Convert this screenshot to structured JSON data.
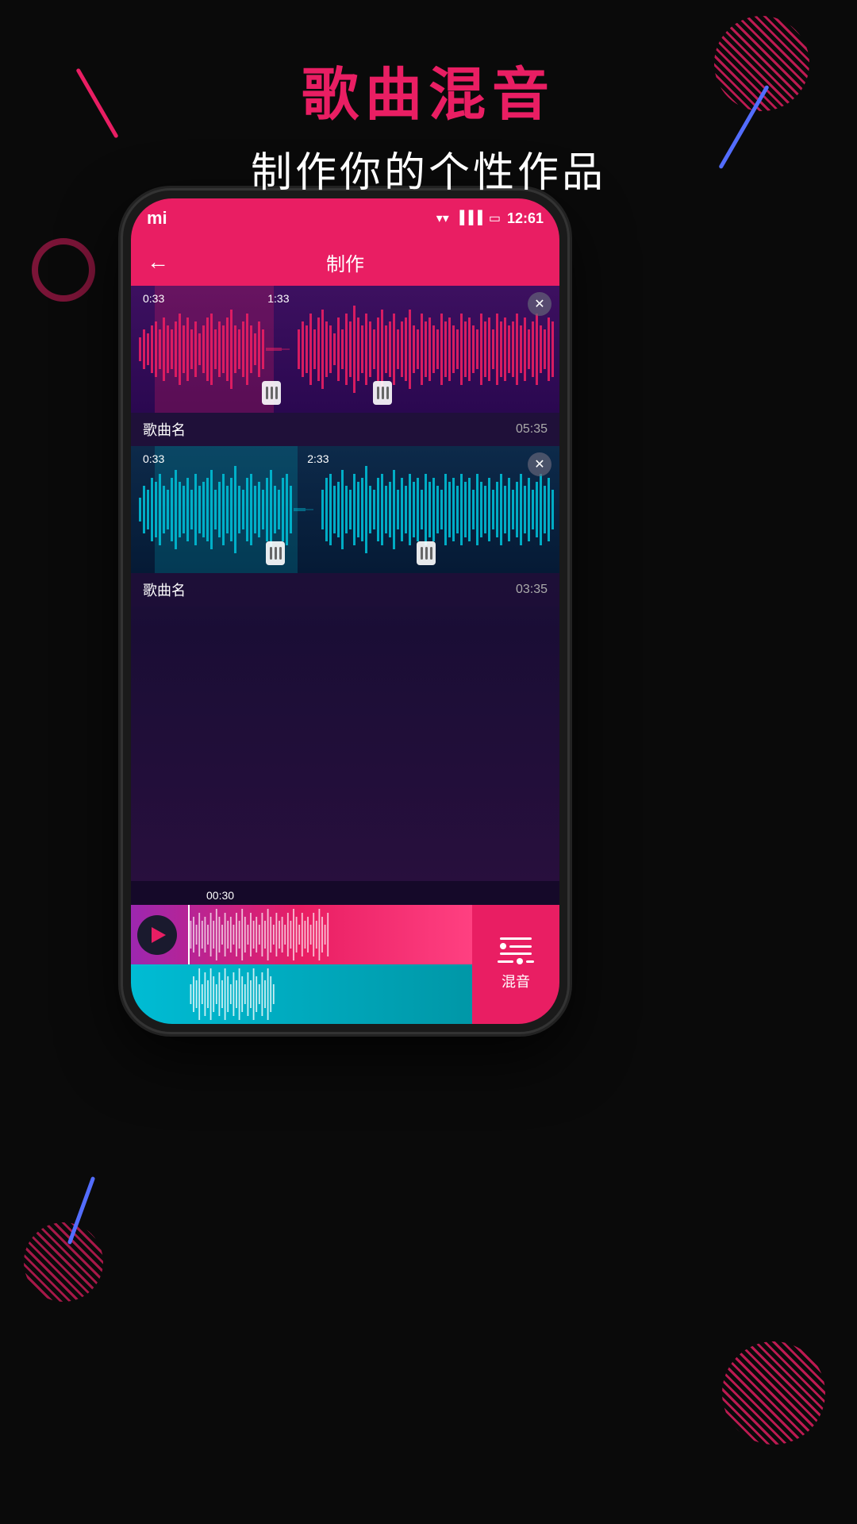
{
  "background": {
    "color": "#0a0a0a"
  },
  "title": {
    "main": "歌曲混音",
    "sub": "制作你的个性作品"
  },
  "phone": {
    "mi_logo": "mi",
    "status": {
      "time": "12:61",
      "wifi": "wifi",
      "signal": "signal",
      "battery": "battery"
    },
    "app_bar": {
      "back_arrow": "←",
      "title": "制作"
    },
    "tracks": [
      {
        "name": "歌曲名",
        "duration": "05:35",
        "time_start": "0:33",
        "time_end": "1:33",
        "color": "pink"
      },
      {
        "name": "歌曲名",
        "duration": "03:35",
        "time_start": "0:33",
        "time_end": "2:33",
        "color": "cyan"
      }
    ],
    "playback": {
      "current_time": "00:30"
    },
    "mix_button": {
      "label": "混音",
      "icon": "sliders"
    },
    "nav": {
      "menu": "☰",
      "home": "□",
      "back": "‹"
    }
  }
}
